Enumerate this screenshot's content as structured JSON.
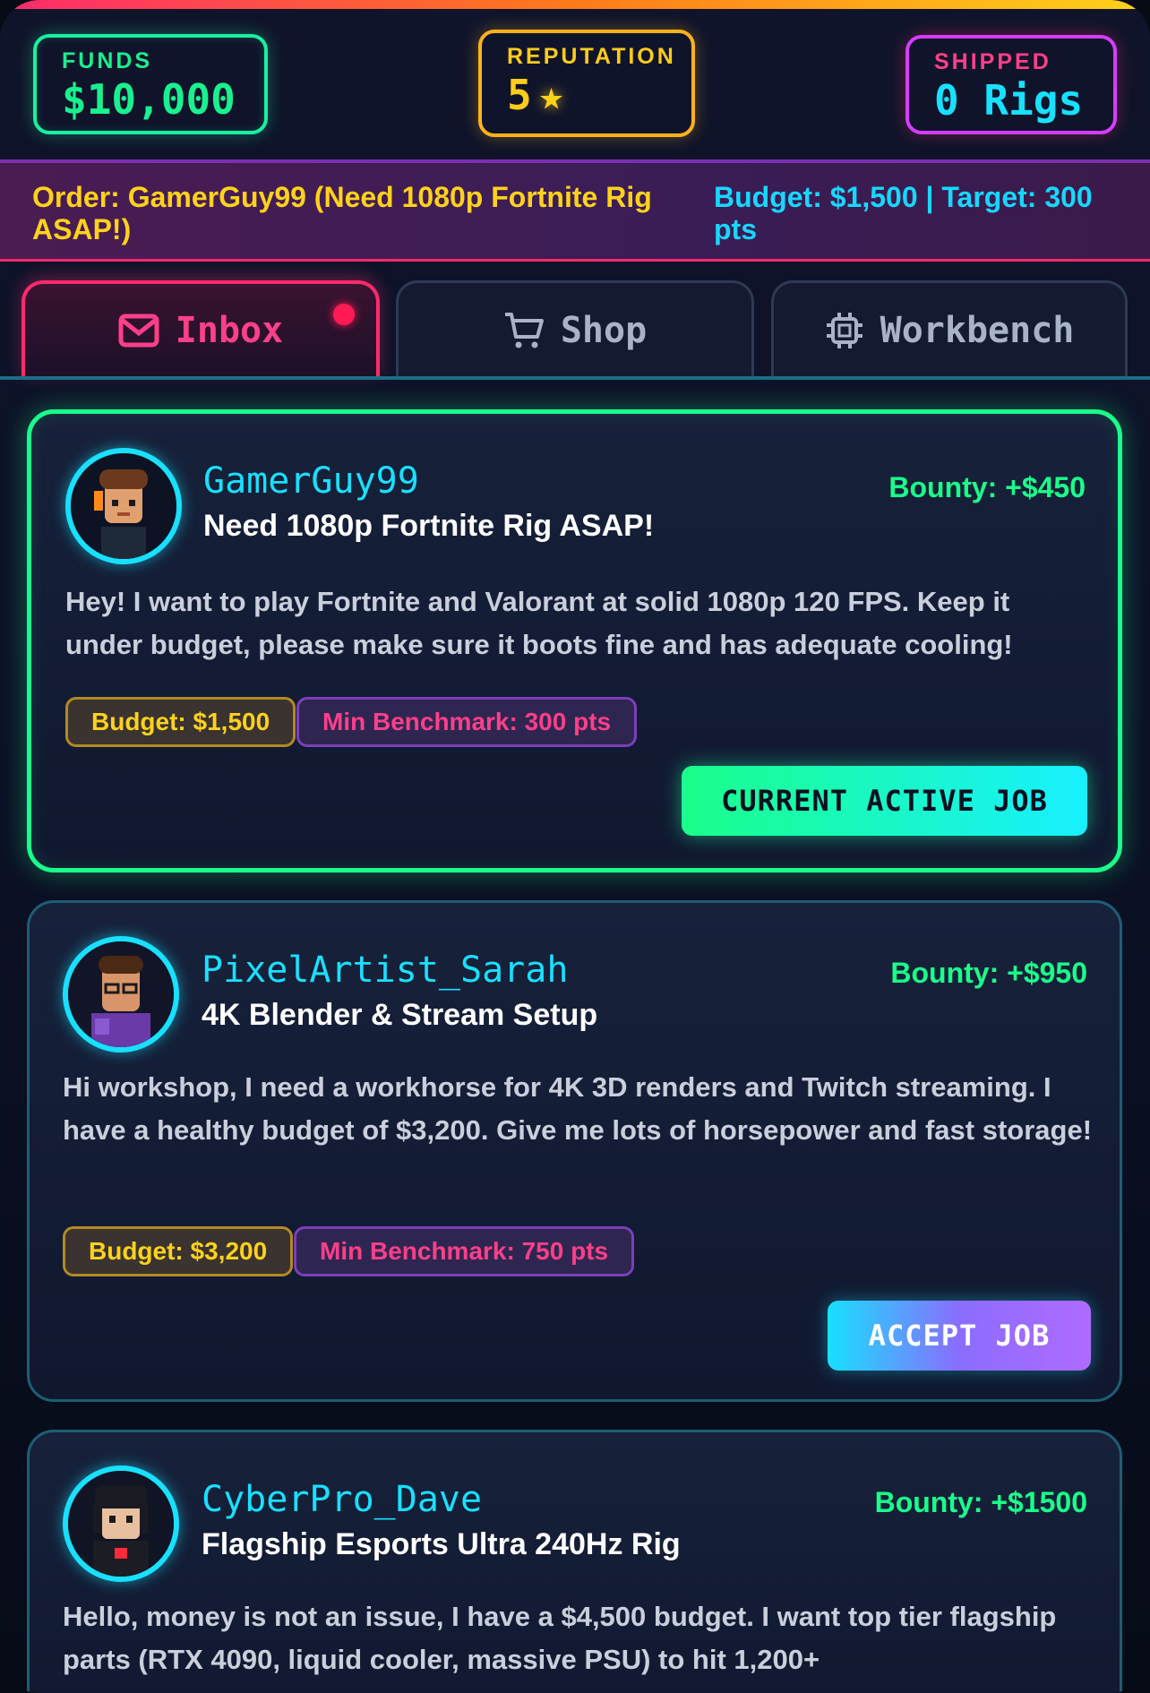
{
  "stats": {
    "funds": {
      "label": "FUNDS",
      "value": "$10,000"
    },
    "reputation": {
      "label": "REPUTATION",
      "value": "5",
      "star": "★"
    },
    "shipped": {
      "label": "SHIPPED",
      "value": "0 Rigs"
    }
  },
  "order": {
    "text": "Order: GamerGuy99 (Need 1080p Fortnite Rig ASAP!)",
    "budget_target": "Budget: $1,500 | Target: 300 pts"
  },
  "tabs": [
    {
      "label": "Inbox",
      "icon": "mail-icon",
      "active": true,
      "notification": true
    },
    {
      "label": "Shop",
      "icon": "cart-icon",
      "active": false
    },
    {
      "label": "Workbench",
      "icon": "cpu-icon",
      "active": false
    }
  ],
  "jobs": [
    {
      "username": "GamerGuy99",
      "title": "Need 1080p Fortnite Rig ASAP!",
      "bounty": "Bounty: +$450",
      "description": "Hey! I want to play Fortnite and Valorant at solid 1080p 120 FPS. Keep it under budget, please make sure it boots fine and has adequate cooling!",
      "budget": "Budget: $1,500",
      "benchmark": "Min Benchmark: 300 pts",
      "button": "CURRENT ACTIVE JOB"
    },
    {
      "username": "PixelArtist_Sarah",
      "title": "4K Blender & Stream Setup",
      "bounty": "Bounty: +$950",
      "description": "Hi workshop, I need a workhorse for 4K 3D renders and Twitch streaming. I have a healthy budget of $3,200. Give me lots of horsepower and fast storage!",
      "budget": "Budget: $3,200",
      "benchmark": "Min Benchmark: 750 pts",
      "button": "ACCEPT JOB"
    },
    {
      "username": "CyberPro_Dave",
      "title": "Flagship Esports Ultra 240Hz Rig",
      "bounty": "Bounty: +$1500",
      "description": "Hello, money is not an issue, I have a $4,500 budget. I want top tier flagship parts (RTX 4090, liquid cooler, massive PSU) to hit 1,200+"
    }
  ],
  "colors": {
    "accent_green": "#1aff8a",
    "accent_cyan": "#18e0ff",
    "accent_pink": "#ff2a6d",
    "accent_yellow": "#ffd21a"
  }
}
